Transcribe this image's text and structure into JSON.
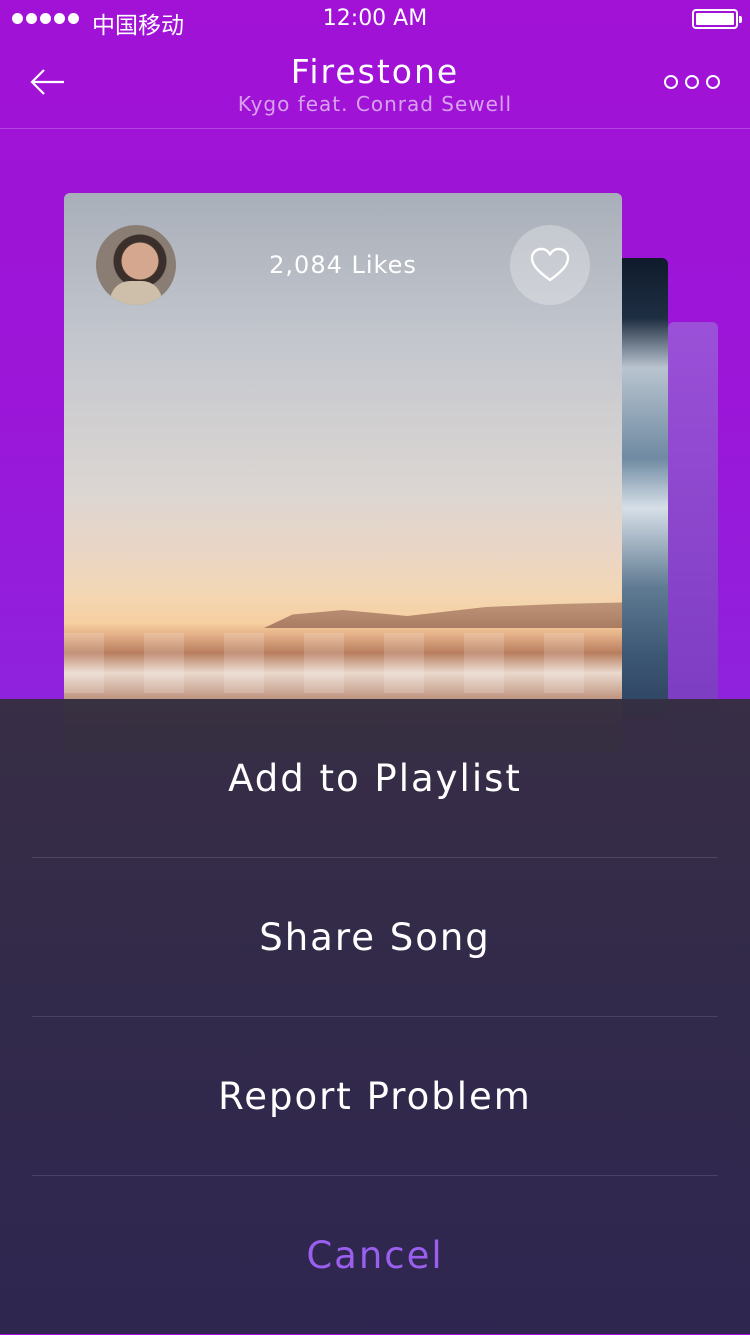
{
  "status_bar": {
    "carrier": "中国移动",
    "time": "12:00 AM"
  },
  "header": {
    "title": "Firestone",
    "subtitle": "Kygo feat. Conrad Sewell",
    "back_icon": "arrow-left-icon",
    "more_icon": "more-dots-icon"
  },
  "card": {
    "likes": "2,084 Likes",
    "like_icon": "heart-outline-icon"
  },
  "action_sheet": {
    "items": [
      {
        "label": "Add to Playlist"
      },
      {
        "label": "Share Song"
      },
      {
        "label": "Report Problem"
      }
    ],
    "cancel_label": "Cancel"
  },
  "colors": {
    "background": "#9b16d8",
    "accent": "#9b5ff0",
    "sheet": "#2f2a44"
  }
}
